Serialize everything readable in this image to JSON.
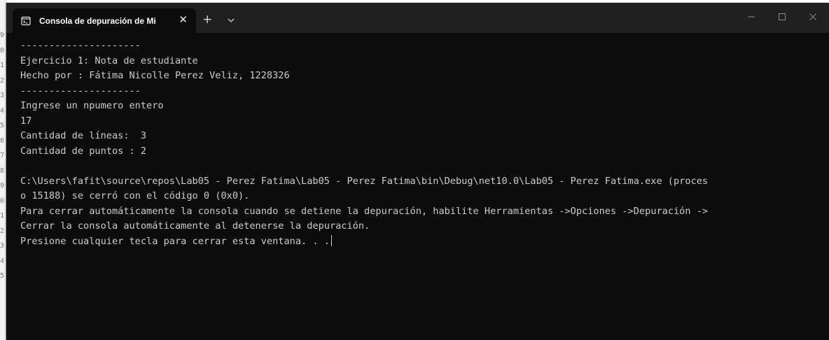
{
  "window": {
    "tab_title": "Consola de depuración de Mi",
    "tab_close_glyph": "✕",
    "new_tab_glyph": "+",
    "colors": {
      "titlebar": "#202020",
      "console_bg": "#0c0c0c",
      "console_text": "#cccccc"
    },
    "icons": {
      "tab": "terminal-icon",
      "dropdown": "chevron-down-icon",
      "minimize": "minimize-icon",
      "maximize": "maximize-icon",
      "close": "close-icon"
    }
  },
  "behind": {
    "line_numbers": [
      "9",
      "0",
      "1",
      "2",
      "3",
      "4",
      "5",
      "6",
      "7",
      "8",
      "9",
      "0",
      "1",
      "2",
      "3",
      "4",
      "5"
    ]
  },
  "console": {
    "lines": [
      "---------------------",
      "Ejercicio 1: Nota de estudiante",
      "Hecho por : Fátima Nicolle Perez Veliz, 1228326",
      "---------------------",
      "Ingrese un npumero entero",
      "17",
      "Cantidad de líneas:  3",
      "Cantidad de puntos : 2",
      "",
      "C:\\Users\\fafit\\source\\repos\\Lab05 - Perez Fatima\\Lab05 - Perez Fatima\\bin\\Debug\\net10.0\\Lab05 - Perez Fatima.exe (proces",
      "o 15188) se cerró con el código 0 (0x0).",
      "Para cerrar automáticamente la consola cuando se detiene la depuración, habilite Herramientas ->Opciones ->Depuración ->",
      "Cerrar la consola automáticamente al detenerse la depuración.",
      "Presione cualquier tecla para cerrar esta ventana. . ."
    ]
  }
}
